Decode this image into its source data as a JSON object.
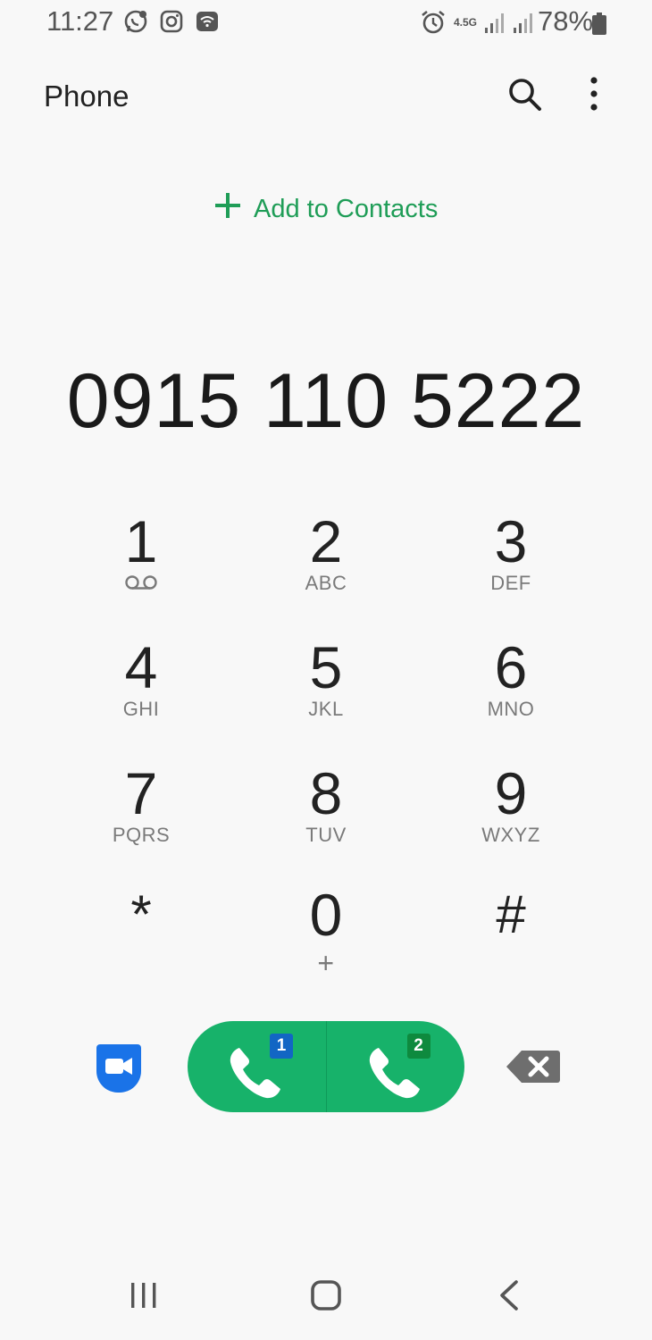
{
  "status_bar": {
    "time": "11:27",
    "network": "4.5G",
    "battery": "78%",
    "icons_left": [
      "whatsapp-icon",
      "instagram-icon",
      "wifi-call-icon"
    ],
    "icons_right": [
      "alarm-icon",
      "signal-icon",
      "signal-icon"
    ]
  },
  "app_bar": {
    "title": "Phone",
    "icons": [
      "search-icon",
      "more-vert-icon"
    ]
  },
  "add_contacts": {
    "label": "Add to Contacts",
    "color": "#1f9d57"
  },
  "dialed_number": "0915 110 5222",
  "keypad": [
    {
      "digit": "1",
      "letters": "",
      "icon": "voicemail-icon"
    },
    {
      "digit": "2",
      "letters": "ABC"
    },
    {
      "digit": "3",
      "letters": "DEF"
    },
    {
      "digit": "4",
      "letters": "GHI"
    },
    {
      "digit": "5",
      "letters": "JKL"
    },
    {
      "digit": "6",
      "letters": "MNO"
    },
    {
      "digit": "7",
      "letters": "PQRS"
    },
    {
      "digit": "8",
      "letters": "TUV"
    },
    {
      "digit": "9",
      "letters": "WXYZ"
    },
    {
      "digit": "*",
      "letters": ""
    },
    {
      "digit": "0",
      "letters": "+"
    },
    {
      "digit": "#",
      "letters": ""
    }
  ],
  "actions": {
    "video_call_icon": "video-call-icon",
    "call_sim1_badge": "1",
    "call_sim2_badge": "2",
    "call_color": "#17b26a",
    "sim1_color": "#1266c4",
    "sim2_color": "#0e8a3e",
    "backspace_icon": "backspace-icon"
  },
  "nav_bar": {
    "icons": [
      "recents-icon",
      "home-icon",
      "back-icon"
    ]
  }
}
